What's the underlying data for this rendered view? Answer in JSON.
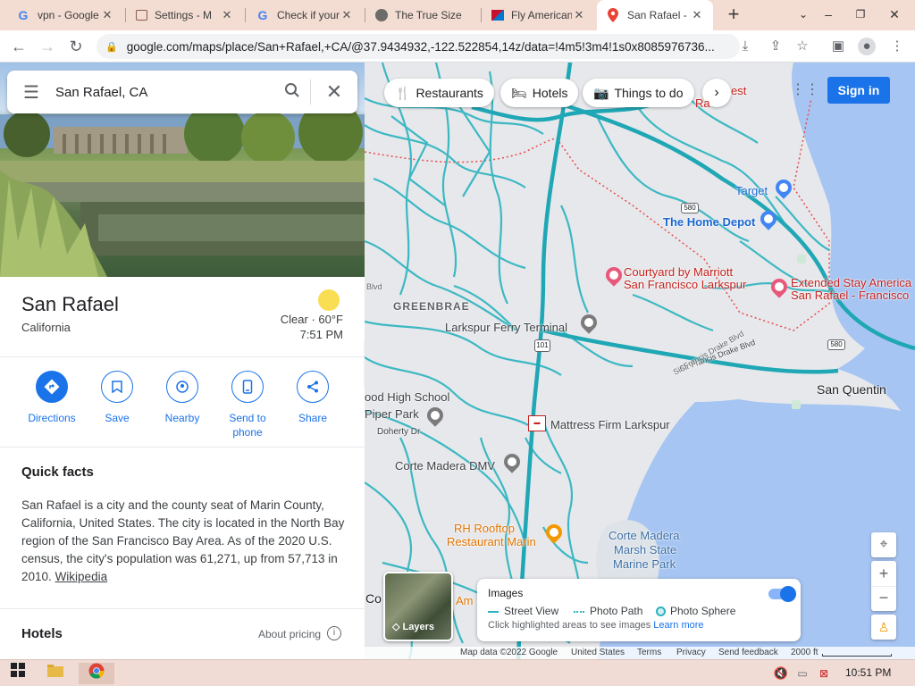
{
  "browser": {
    "tabs": [
      {
        "title": "vpn - Google",
        "favicon": "G"
      },
      {
        "title": "Settings - M",
        "favicon": "settings"
      },
      {
        "title": "Check if your",
        "favicon": "G"
      },
      {
        "title": "The True Size",
        "favicon": "globe"
      },
      {
        "title": "Fly American",
        "favicon": "aa"
      },
      {
        "title": "San Rafael -",
        "favicon": "maps-pin",
        "active": true
      }
    ],
    "new_tab": "+",
    "url": "google.com/maps/place/San+Rafael,+CA/@37.9434932,-122.522854,14z/data=!4m5!3m4!1s0x8085976736..."
  },
  "search": {
    "query": "San Rafael, CA"
  },
  "place": {
    "name": "San Rafael",
    "region": "California",
    "weather": {
      "condition": "Clear · 60°F",
      "time": "7:51 PM"
    }
  },
  "actions": [
    {
      "label": "Directions",
      "icon": "directions-icon"
    },
    {
      "label": "Save",
      "icon": "bookmark-icon"
    },
    {
      "label": "Nearby",
      "icon": "nearby-icon"
    },
    {
      "label": "Send to phone",
      "icon": "phone-icon"
    },
    {
      "label": "Share",
      "icon": "share-icon"
    }
  ],
  "quick_facts": {
    "title": "Quick facts",
    "text": "San Rafael is a city and the county seat of Marin County, California, United States. The city is located in the North Bay region of the San Francisco Bay Area. As of the 2020 U.S. census, the city's population was 61,271, up from 57,713 in 2010.",
    "link": "Wikipedia"
  },
  "hotels": {
    "title": "Hotels",
    "about_pricing": "About pricing"
  },
  "map": {
    "chips": [
      "Restaurants",
      "Hotels",
      "Things to do"
    ],
    "sign_in": "Sign in",
    "labels": {
      "greenbrae": "GREENBRAE",
      "larkspur_ferry": "Larkspur Ferry Terminal",
      "target": "Target",
      "home_depot": "The Home Depot",
      "courtyard_1": "Courtyard by Marriott",
      "courtyard_2": "San Francisco Larkspur",
      "extended_1": "Extended Stay America",
      "extended_2": "San Rafael - Francisco",
      "san_quentin": "San Quentin",
      "hood_high": "ood High School",
      "piper_park": "Piper Park",
      "doherty": "Doherty Dr",
      "mattress": "Mattress Firm Larkspur",
      "corte_dmv": "Corte Madera DMV",
      "rh_rooftop_1": "RH Rooftop",
      "rh_rooftop_2": "Restaurant Marin",
      "marsh_1": "Corte Madera",
      "marsh_2": "Marsh State",
      "marsh_3": "Marine Park",
      "est": "est",
      "ra": "Ra",
      "co": "Co",
      "am": "Am",
      "road_101": "101",
      "road_580a": "580",
      "road_580b": "580",
      "sf_drake": "Sir Francis Drake Blvd",
      "sf_drake_2": "Sir Francis Drake Blvd",
      "blvd": "Blvd"
    },
    "layers_label": "Layers",
    "images_card": {
      "title": "Images",
      "street_view": "Street View",
      "photo_path": "Photo Path",
      "photo_sphere": "Photo Sphere",
      "hint": "Click highlighted areas to see images",
      "learn_more": "Learn more"
    },
    "attribution": [
      "Map data ©2022 Google",
      "United States",
      "Terms",
      "Privacy",
      "Send feedback",
      "2000 ft"
    ]
  },
  "taskbar": {
    "clock": "10:51 PM"
  },
  "colors": {
    "accent": "#1a73e8",
    "road": "#2ab3bf",
    "water": "#a7c5f2",
    "land": "#e6e8eb"
  }
}
